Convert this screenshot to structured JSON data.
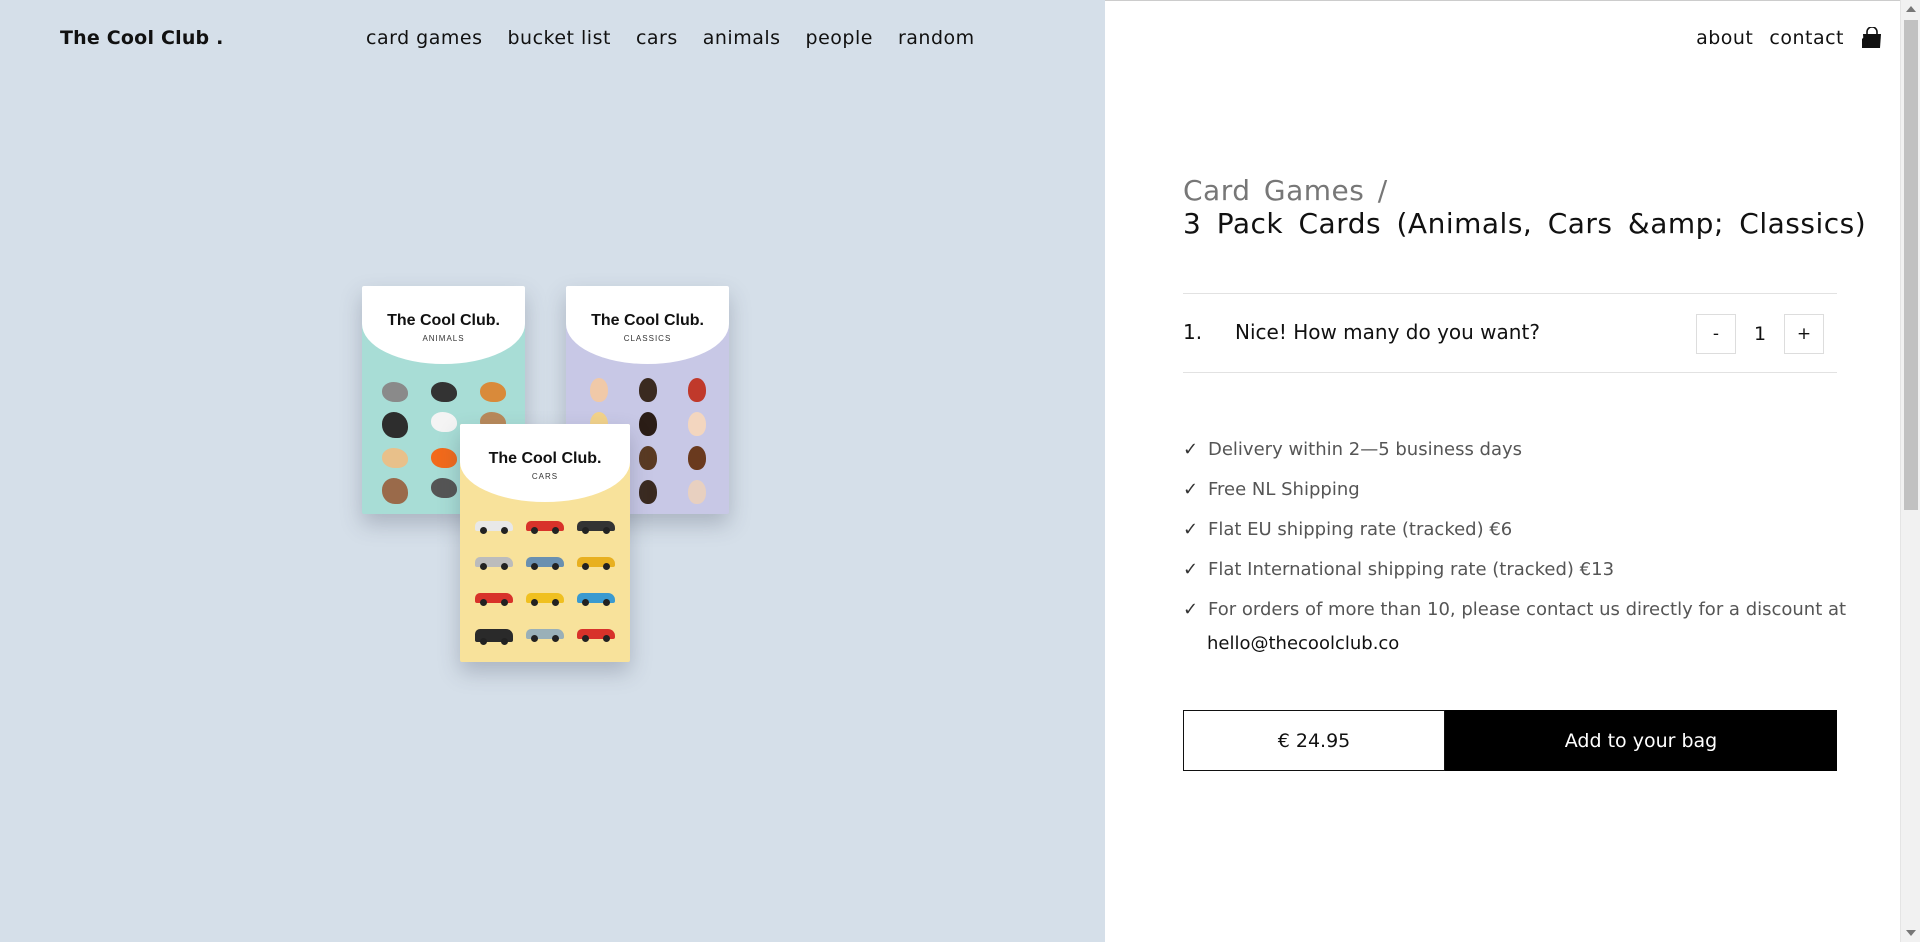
{
  "header": {
    "logo": "The Cool Club .",
    "nav": [
      "card games",
      "bucket list",
      "cars",
      "animals",
      "people",
      "random"
    ],
    "right_nav": {
      "about": "about",
      "contact": "contact"
    },
    "bag_icon": "shopping-bag-icon"
  },
  "packs": {
    "animals": {
      "title": "The Cool Club.",
      "subtitle": "ANIMALS",
      "color": "#a8ddd6"
    },
    "classics": {
      "title": "The Cool Club.",
      "subtitle": "CLASSICS",
      "color": "#c8c8e6"
    },
    "cars": {
      "title": "The Cool Club.",
      "subtitle": "CARS",
      "color": "#f8e29b"
    }
  },
  "product": {
    "breadcrumb": "Card Games /",
    "title": "3 Pack Cards (Animals, Cars &amp; Classics)",
    "quantity": {
      "number": "1.",
      "question": "Nice! How many do you want?",
      "minus": "-",
      "value": "1",
      "plus": "+"
    },
    "features": [
      "Delivery within 2—5 business days",
      "Free NL Shipping",
      "Flat EU shipping rate (tracked) €6",
      "Flat International shipping rate (tracked) €13",
      "For orders of more than 10, please contact us directly for a discount at"
    ],
    "check": "✓",
    "email": "hello@thecoolclub.co",
    "price": "€ 24.95",
    "add_button": "Add to your bag"
  },
  "colors": {
    "left_bg": "#d5dfe9",
    "button_bg": "#000000"
  }
}
